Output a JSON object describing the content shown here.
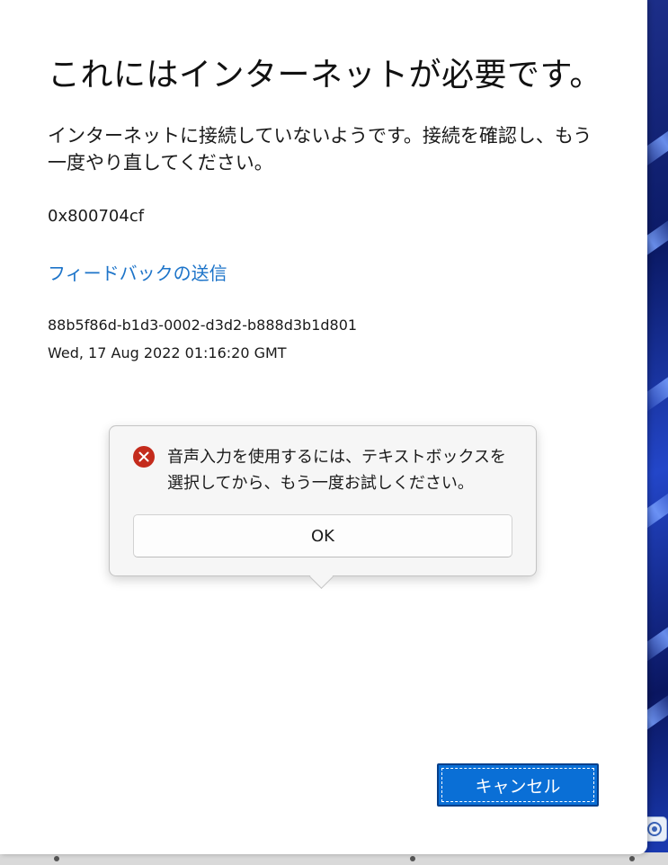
{
  "dialog": {
    "title": "これにはインターネットが必要です。",
    "message": "インターネットに接続していないようです。接続を確認し、もう一度やり直してください。",
    "error_code": "0x800704cf",
    "feedback_link": "フィードバックの送信",
    "correlation_id": "88b5f86d-b1d3-0002-d3d2-b888d3b1d801",
    "timestamp": "Wed, 17 Aug 2022 01:16:20 GMT",
    "cancel_label": "キャンセル"
  },
  "flyout": {
    "icon": "error-icon",
    "message": "音声入力を使用するには、テキストボックスを選択してから、もう一度お試しください。",
    "ok_label": "OK"
  },
  "colors": {
    "link": "#1d74c9",
    "primary_button": "#0a6fd6",
    "error_icon": "#c42b1c"
  }
}
